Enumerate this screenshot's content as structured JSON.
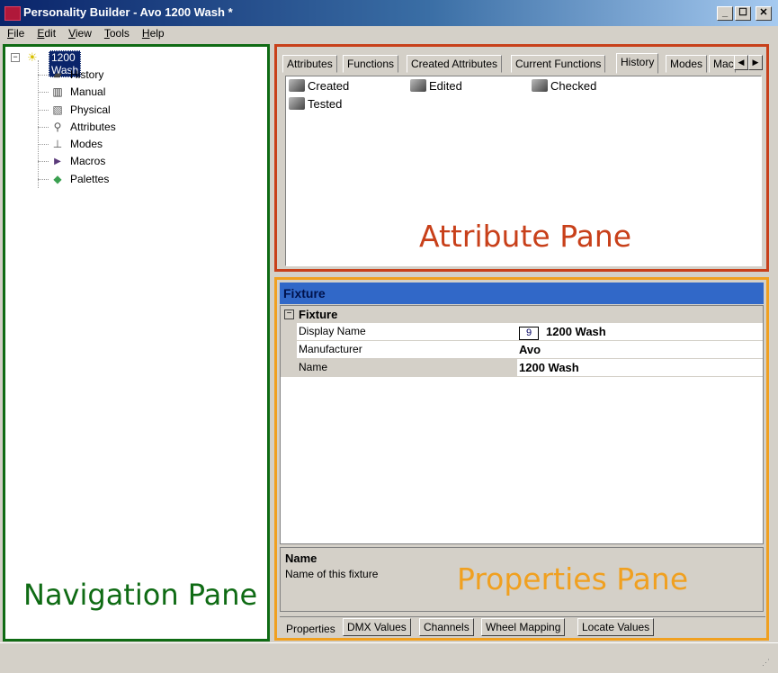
{
  "window": {
    "title": "Personality Builder - Avo 1200 Wash *",
    "minimize_glyph": "_",
    "maximize_glyph": "☐",
    "close_glyph": "✕"
  },
  "menu": [
    {
      "accel": "F",
      "rest": "ile"
    },
    {
      "accel": "E",
      "rest": "dit"
    },
    {
      "accel": "V",
      "rest": "iew"
    },
    {
      "accel": "T",
      "rest": "ools"
    },
    {
      "accel": "H",
      "rest": "elp"
    }
  ],
  "navigation": {
    "root": {
      "label": "1200 Wash",
      "icon": "lightbulb-icon",
      "expander": "−"
    },
    "children": [
      {
        "label": "History",
        "icon": "history-icon",
        "glyph": "▰"
      },
      {
        "label": "Manual",
        "icon": "manual-icon",
        "glyph": "▥"
      },
      {
        "label": "Physical",
        "icon": "physical-icon",
        "glyph": "▧"
      },
      {
        "label": "Attributes",
        "icon": "wrench-icon",
        "glyph": "⚲"
      },
      {
        "label": "Modes",
        "icon": "modes-icon",
        "glyph": "⊥"
      },
      {
        "label": "Macros",
        "icon": "macros-icon",
        "glyph": "▶"
      },
      {
        "label": "Palettes",
        "icon": "palettes-icon",
        "glyph": "◆"
      }
    ],
    "caption": "Navigation Pane"
  },
  "attribute_pane": {
    "tabs": [
      "Attributes",
      "Functions",
      "Created Attributes",
      "Current Functions",
      "History",
      "Modes",
      "Macros"
    ],
    "active_tab": "History",
    "scroll_left": "◀",
    "scroll_right": "▶",
    "history_items": [
      "Created",
      "Edited",
      "Checked",
      "Tested"
    ],
    "caption": "Attribute Pane"
  },
  "properties_pane": {
    "header": "Fixture",
    "category": {
      "label": "Fixture",
      "collapse": "−"
    },
    "rows": [
      {
        "name": "Display Name",
        "value": "1200 Wash",
        "badge": "9"
      },
      {
        "name": "Manufacturer",
        "value": "Avo"
      },
      {
        "name": "Name",
        "value": "1200 Wash"
      }
    ],
    "description": {
      "title": "Name",
      "text": "Name of this fixture"
    },
    "bottom_tabs": [
      "Properties",
      "DMX Values",
      "Channels",
      "Wheel Mapping",
      "Locate Values"
    ],
    "active_bottom_tab": "Properties",
    "caption": "Properties Pane"
  },
  "colors": {
    "navigation_border": "#0f6b14",
    "attribute_border": "#c8401a",
    "properties_border": "#f0a020",
    "header_blue": "#3168c8"
  }
}
